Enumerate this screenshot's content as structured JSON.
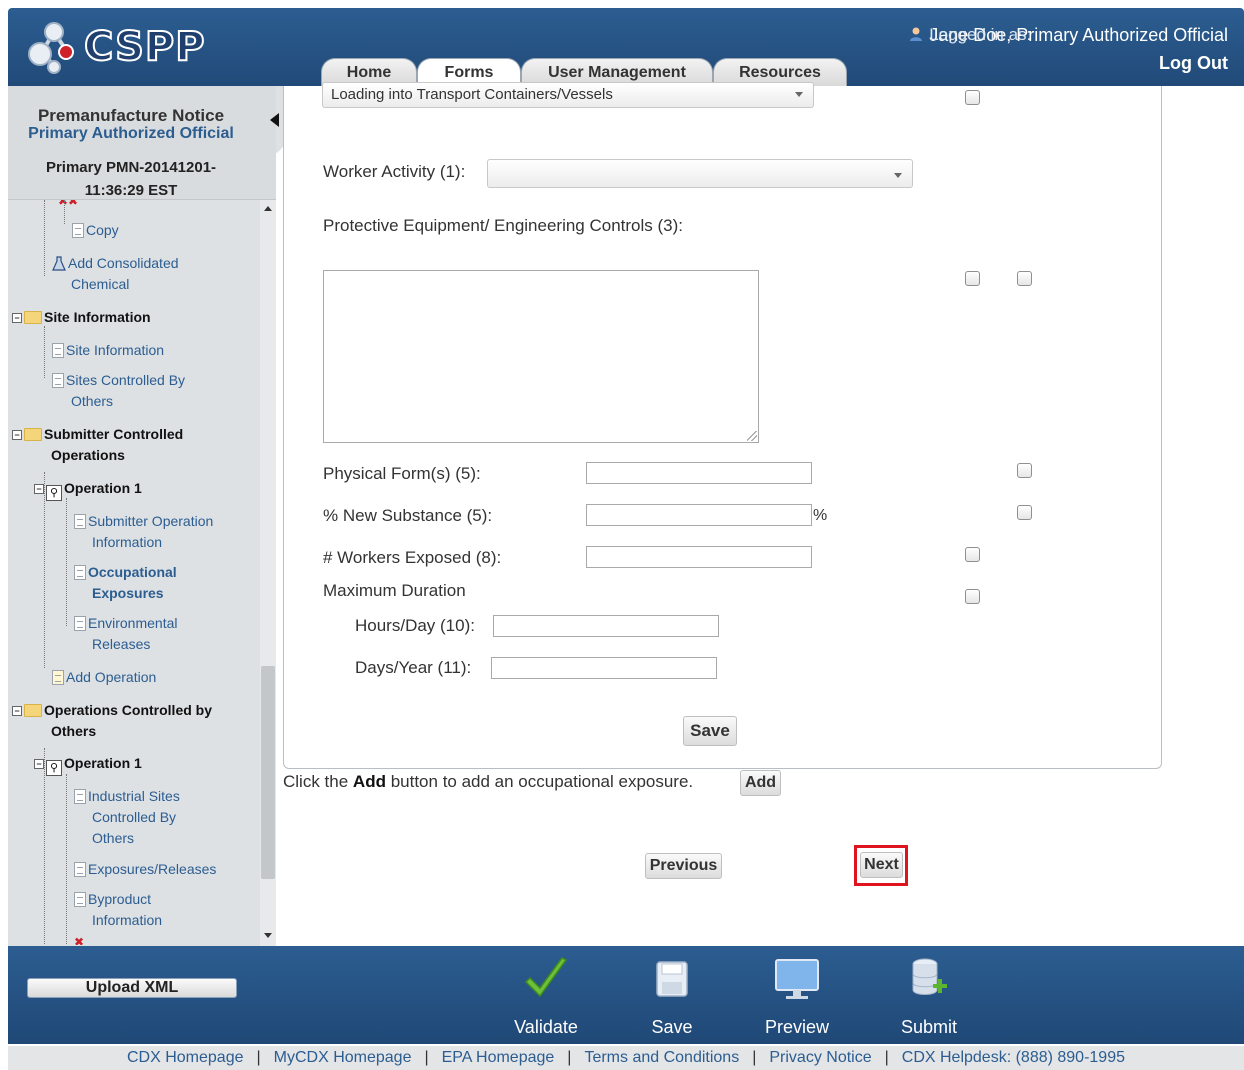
{
  "header": {
    "logo_text": "CSPP",
    "login_label": "Logged in as:",
    "login_user": "Jane Doe, Primary Authorized Official",
    "logout_label": "Log Out",
    "tabs": [
      {
        "label": "Home",
        "active": false
      },
      {
        "label": "Forms",
        "active": true
      },
      {
        "label": "User Management",
        "active": false
      },
      {
        "label": "Resources",
        "active": false
      }
    ]
  },
  "sidebar": {
    "title": "Premanufacture Notice",
    "role": "Primary Authorized Official",
    "pmn_line1": "Primary PMN-20141201-",
    "pmn_line2": "11:36:29 EST",
    "tree": [
      {
        "label": "Copy",
        "icon": "document-icon"
      },
      {
        "label": "Add Consolidated",
        "icon": "flask-icon"
      },
      {
        "label": "Chemical"
      },
      {
        "label": "Site Information",
        "icon": "folder-icon"
      },
      {
        "label": "Site Information",
        "icon": "document-icon"
      },
      {
        "label": "Sites Controlled By",
        "icon": "document-icon"
      },
      {
        "label": "Others"
      },
      {
        "label": "Submitter Controlled",
        "icon": "folder-icon"
      },
      {
        "label": "Operations"
      },
      {
        "label": "Operation 1",
        "icon": "operation-icon"
      },
      {
        "label": "Submitter Operation",
        "icon": "document-icon"
      },
      {
        "label": "Information"
      },
      {
        "label": "Occupational",
        "icon": "document-icon"
      },
      {
        "label": "Exposures"
      },
      {
        "label": "Environmental",
        "icon": "document-icon"
      },
      {
        "label": "Releases"
      },
      {
        "label": "Add Operation",
        "icon": "add-document-icon"
      },
      {
        "label": "Operations Controlled by",
        "icon": "folder-icon"
      },
      {
        "label": "Others"
      },
      {
        "label": "Operation 1",
        "icon": "operation-icon"
      },
      {
        "label": "Industrial Sites",
        "icon": "document-icon"
      },
      {
        "label": "Controlled By"
      },
      {
        "label": "Others"
      },
      {
        "label": "Exposures/Releases",
        "icon": "document-icon"
      },
      {
        "label": "Byproduct",
        "icon": "document-icon"
      },
      {
        "label": "Information"
      }
    ]
  },
  "form": {
    "top_select_value": "Loading into Transport Containers/Vessels",
    "worker_activity_label": "Worker Activity (1):",
    "worker_activity_value": "",
    "protective_label": "Protective Equipment/ Engineering Controls (3):",
    "protective_value": "",
    "physical_form_label": "Physical Form(s) (5):",
    "physical_form_value": "",
    "new_substance_label": "% New Substance (5):",
    "new_substance_value": "",
    "percent_sign": "%",
    "workers_exposed_label": "# Workers Exposed (8):",
    "workers_exposed_value": "",
    "max_duration_label": "Maximum Duration",
    "hours_day_label": "Hours/Day (10):",
    "hours_day_value": "",
    "days_year_label": "Days/Year (11):",
    "days_year_value": "",
    "save_label": "Save"
  },
  "add_line": {
    "prefix": "Click the",
    "bold": "Add",
    "suffix": "button to add an occupational exposure.",
    "button_label": "Add"
  },
  "nav": {
    "previous_label": "Previous",
    "next_label": "Next"
  },
  "footer": {
    "upload_label": "Upload XML",
    "actions": [
      {
        "label": "Validate",
        "icon": "checkmark-icon"
      },
      {
        "label": "Save",
        "icon": "floppy-disk-icon"
      },
      {
        "label": "Preview",
        "icon": "monitor-icon"
      },
      {
        "label": "Submit",
        "icon": "database-add-icon"
      }
    ],
    "links": [
      "CDX Homepage",
      "MyCDX Homepage",
      "EPA Homepage",
      "Terms and Conditions",
      "Privacy Notice",
      "CDX Helpdesk: (888) 890-1995"
    ]
  }
}
